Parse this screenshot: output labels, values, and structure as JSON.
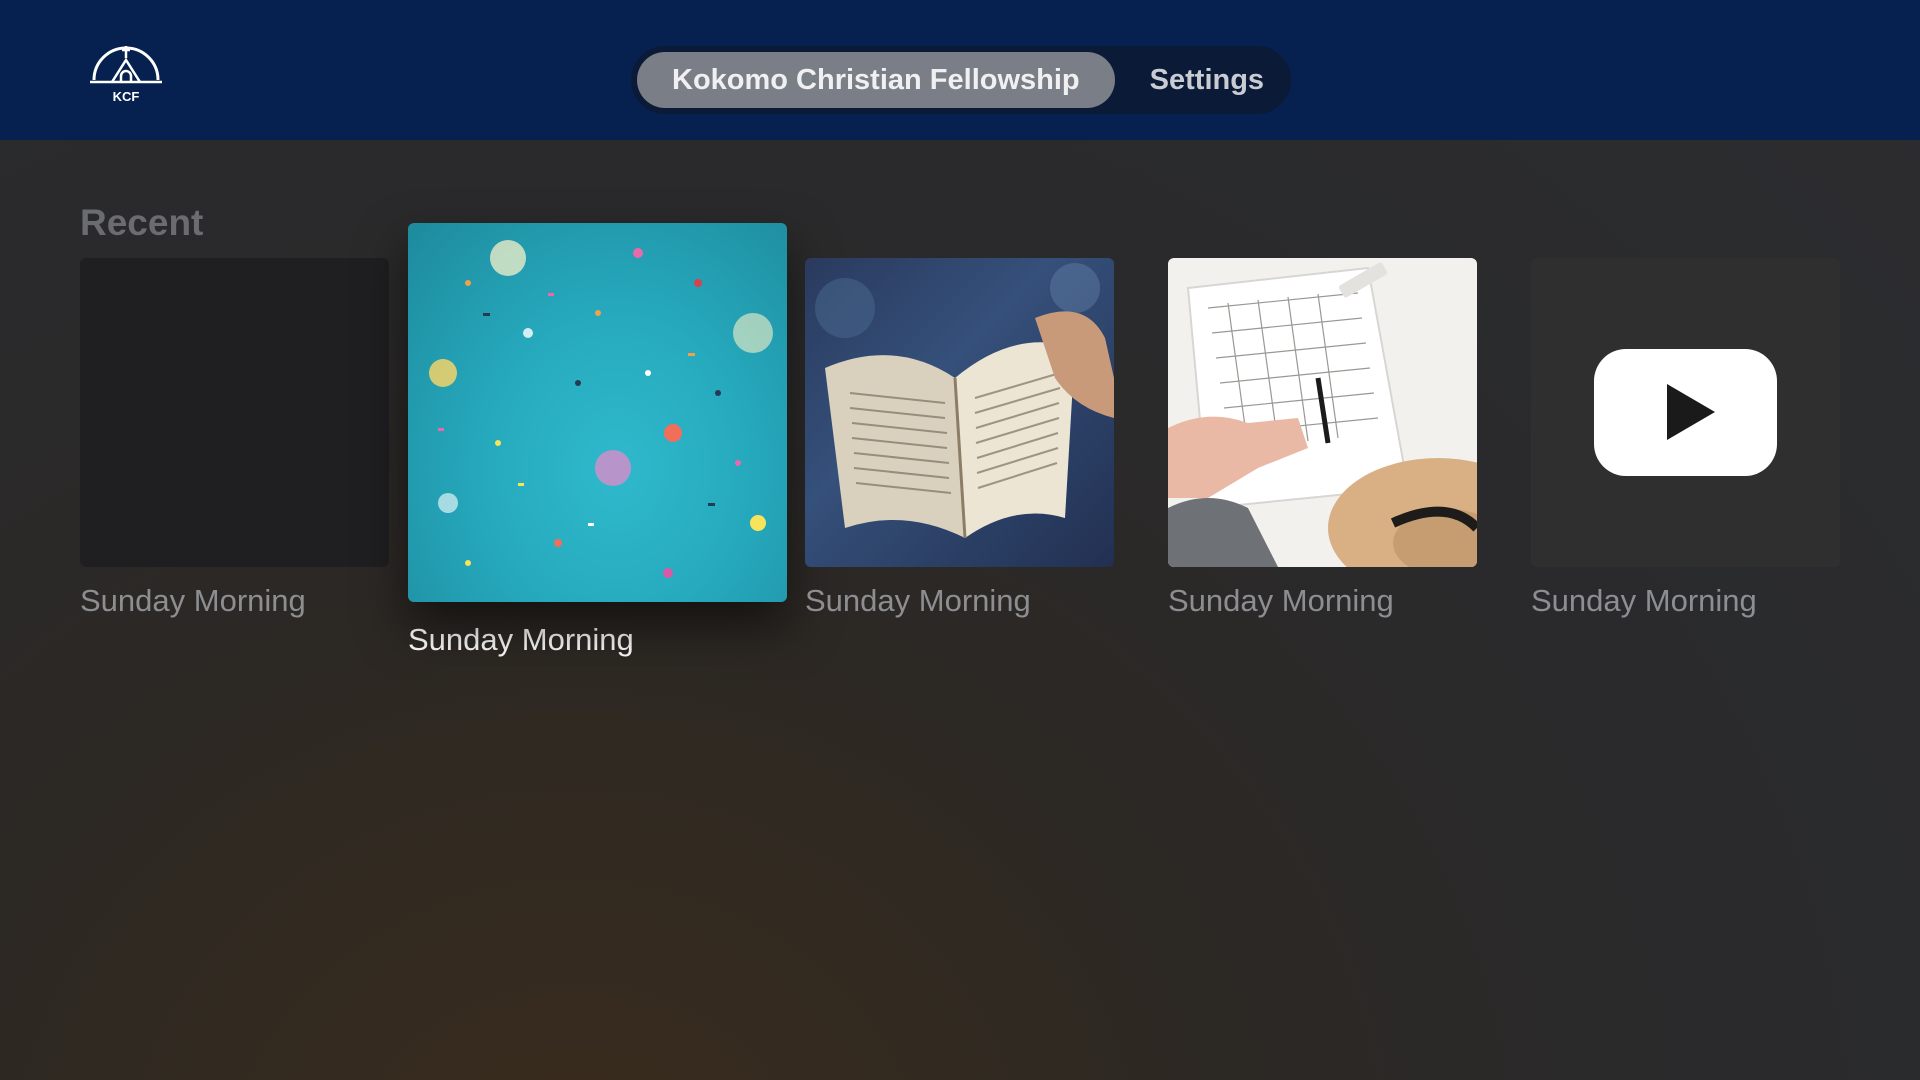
{
  "app": {
    "logo_text": "KCF"
  },
  "tabs": [
    {
      "label": "Kokomo Christian Fellowship",
      "active": true
    },
    {
      "label": "Settings",
      "active": false
    }
  ],
  "section": {
    "title": "Recent"
  },
  "tiles": [
    {
      "caption": "Sunday Morning",
      "artwork": "dark-placeholder",
      "focused": false
    },
    {
      "caption": "Sunday Morning",
      "artwork": "confetti-photo",
      "focused": true
    },
    {
      "caption": "Sunday Morning",
      "artwork": "open-bible-photo",
      "focused": false
    },
    {
      "caption": "Sunday Morning",
      "artwork": "planner-hat-photo",
      "focused": false
    },
    {
      "caption": "Sunday Morning",
      "artwork": "youtube-play-icon",
      "focused": false
    }
  ],
  "colors": {
    "topbar": "#062050",
    "active_tab": "#7a7e87",
    "tabbar": "#0b1a36"
  }
}
